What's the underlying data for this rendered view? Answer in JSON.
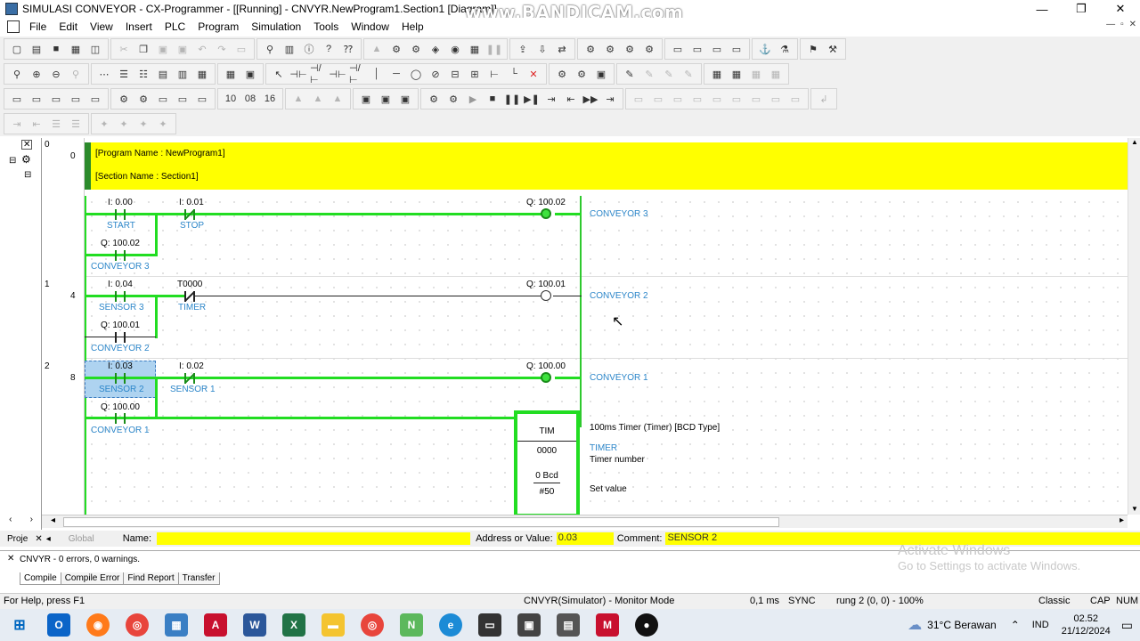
{
  "window": {
    "title": "SIMULASI CONVEYOR - CX-Programmer - [[Running] - CNVYR.NewProgram1.Section1 [Diagram]]",
    "watermark": "www.BANDICAM.com",
    "min": "—",
    "max": "❐",
    "close": "✕"
  },
  "menu": [
    "File",
    "Edit",
    "View",
    "Insert",
    "PLC",
    "Program",
    "Simulation",
    "Tools",
    "Window",
    "Help"
  ],
  "mdi": {
    "min": "—",
    "restore": "▫",
    "close": "✕"
  },
  "rung_numbers": [
    {
      "rung": "0",
      "step": "0"
    },
    {
      "rung": "1",
      "step": "4"
    },
    {
      "rung": "2",
      "step": "8"
    }
  ],
  "comments": {
    "program": "[Program Name : NewProgram1]",
    "section": "[Section Name : Section1]"
  },
  "rung0": {
    "start_addr": "I: 0.00",
    "start_sym": "START",
    "stop_addr": "I: 0.01",
    "stop_sym": "STOP",
    "seal_addr": "Q: 100.02",
    "seal_sym": "CONVEYOR 3",
    "coil_addr": "Q: 100.02",
    "coil_sym": "CONVEYOR 3"
  },
  "rung1": {
    "sensor_addr": "I: 0.04",
    "sensor_sym": "SENSOR 3",
    "timer_addr": "T0000",
    "timer_sym": "TIMER",
    "seal_addr": "Q: 100.01",
    "seal_sym": "CONVEYOR 2",
    "coil_addr": "Q: 100.01",
    "coil_sym": "CONVEYOR 2"
  },
  "rung2": {
    "sensor2_addr": "I: 0.03",
    "sensor2_sym": "SENSOR 2",
    "sensor1_addr": "I: 0.02",
    "sensor1_sym": "SENSOR 1",
    "seal_addr": "Q: 100.00",
    "seal_sym": "CONVEYOR 1",
    "coil_addr": "Q: 100.00",
    "coil_sym": "CONVEYOR 1",
    "tim": {
      "name": "TIM",
      "number": "0000",
      "bcd": "0 Bcd",
      "set": "#50",
      "desc": "100ms Timer (Timer) [BCD Type]",
      "sym": "TIMER",
      "num_label": "Timer number",
      "set_label": "Set value"
    }
  },
  "props": {
    "project_tab": "Proje",
    "global_tab": "Global",
    "name_label": "Name:",
    "name_value": "",
    "address_label": "Address or Value:",
    "address_value": "0.03",
    "comment_label": "Comment:",
    "comment_value": "SENSOR 2"
  },
  "output": {
    "message": "CNVYR - 0 errors, 0 warnings.",
    "tabs": [
      "Compile",
      "Compile Error",
      "Find Report",
      "Transfer"
    ]
  },
  "activate": {
    "line1": "Activate Windows",
    "line2": "Go to Settings to activate Windows."
  },
  "status": {
    "help": "For Help, press F1",
    "mode": "CNVYR(Simulator) - Monitor Mode",
    "cycle": "0,1 ms",
    "sync": "SYNC",
    "rung": "rung 2 (0, 0)  - 100%",
    "style": "Classic",
    "cap": "CAP",
    "num": "NUM"
  },
  "taskbar": {
    "weather": "31°C  Berawan",
    "lang": "IND",
    "time": "02.52",
    "date": "21/12/2024"
  },
  "colors": {
    "energized": "#22dd22",
    "comment_band": "#ffff00",
    "symbol_text": "#2c86c9",
    "selection": "#aed3f0"
  }
}
